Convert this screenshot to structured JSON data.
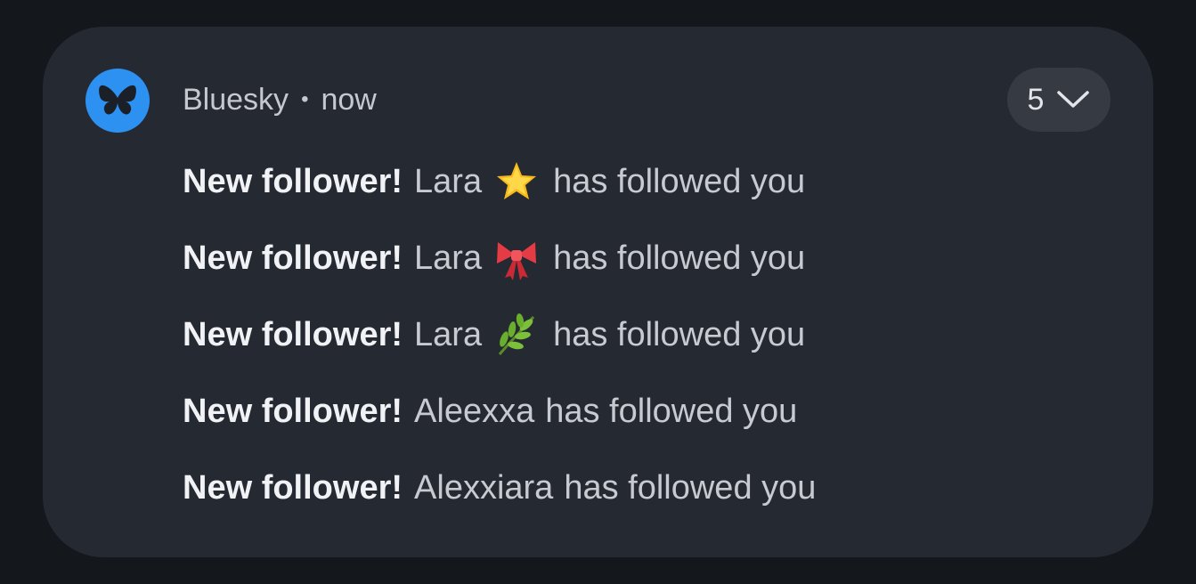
{
  "notification": {
    "app_name": "Bluesky",
    "separator": "•",
    "time": "now",
    "count": "5",
    "icon": "butterfly-icon",
    "expand_icon": "chevron-down-icon",
    "accent_color": "#2c91f0",
    "lines": [
      {
        "title": "New follower!",
        "name": "Lara",
        "emoji": "star-emoji-icon",
        "text": "has followed you"
      },
      {
        "title": "New follower!",
        "name": "Lara",
        "emoji": "ribbon-emoji-icon",
        "text": "has followed you"
      },
      {
        "title": "New follower!",
        "name": "Lara",
        "emoji": "herb-emoji-icon",
        "text": "has followed you"
      },
      {
        "title": "New follower!",
        "name": "Aleexxa",
        "emoji": "",
        "text": "has followed you"
      },
      {
        "title": "New follower!",
        "name": "Alexxiara",
        "emoji": "",
        "text": "has followed you"
      }
    ]
  }
}
